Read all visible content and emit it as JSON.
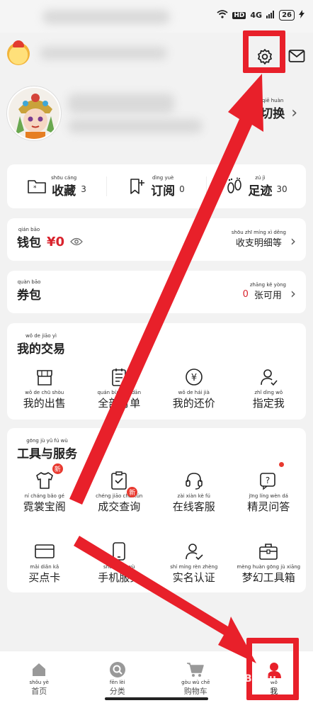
{
  "status_bar": {
    "battery": "26",
    "network_badge": "HD",
    "signal": "4G"
  },
  "header": {
    "settings_icon": "gear-icon",
    "mail_icon": "mail-icon"
  },
  "profile": {
    "switch": {
      "pinyin": "qiē huàn",
      "label": "切换"
    }
  },
  "favorites": [
    {
      "pinyin": "shōu cáng",
      "label": "收藏",
      "count": "3",
      "icon": "folder-icon"
    },
    {
      "pinyin": "dìng yuè",
      "label": "订阅",
      "count": "0",
      "icon": "bookmark-plus-icon"
    },
    {
      "pinyin": "zú jì",
      "label": "足迹",
      "count": "30",
      "icon": "footprint-icon"
    }
  ],
  "wallet": {
    "pinyin": "qián bāo",
    "label": "钱包",
    "amount": "¥0",
    "detail_pinyin": "shōu zhī míng xì děng",
    "detail_label": "收支明细等"
  },
  "coupon": {
    "pinyin": "quàn bāo",
    "label": "券包",
    "count": "0",
    "detail_pinyin": "zhāng kě yòng",
    "detail_label": "张可用"
  },
  "trades": {
    "title_pinyin": "wǒ de jiāo yì",
    "title": "我的交易",
    "items": [
      {
        "pinyin": "wǒ de chū shòu",
        "label": "我的出售",
        "icon": "shop-icon"
      },
      {
        "pinyin": "quán bù dìng dān",
        "label": "全部订单",
        "icon": "order-list-icon"
      },
      {
        "pinyin": "wǒ de hái jià",
        "label": "我的还价",
        "icon": "yen-coin-icon"
      },
      {
        "pinyin": "zhǐ dìng wǒ",
        "label": "指定我",
        "icon": "user-assign-icon"
      }
    ]
  },
  "tools": {
    "title_pinyin": "gōng jù yǔ fú wù",
    "title": "工具与服务",
    "row1": [
      {
        "pinyin": "ní cháng bǎo gé",
        "label": "霓裳宝阁",
        "icon": "tshirt-icon",
        "badge": "新"
      },
      {
        "pinyin": "chéng jiāo chá xún",
        "label": "成交查询",
        "icon": "clipboard-check-icon",
        "badge": "新"
      },
      {
        "pinyin": "zài xiàn kè fú",
        "label": "在线客服",
        "icon": "headset-icon"
      },
      {
        "pinyin": "jīng líng wèn dá",
        "label": "精灵问答",
        "icon": "question-icon",
        "dot": true
      }
    ],
    "row2": [
      {
        "pinyin": "mǎi diǎn kǎ",
        "label": "买点卡",
        "icon": "card-icon"
      },
      {
        "pinyin": "shǒu jī fú wù",
        "label": "手机服务",
        "icon": "phone-icon"
      },
      {
        "pinyin": "shí míng rèn zhèng",
        "label": "实名认证",
        "icon": "id-verify-icon"
      },
      {
        "pinyin": "mèng huàn gōng jù xiāng",
        "label": "梦幻工具箱",
        "icon": "toolbox-icon"
      }
    ]
  },
  "tabbar": [
    {
      "pinyin": "shǒu yè",
      "label": "首页",
      "icon": "home-icon"
    },
    {
      "pinyin": "fēn lèi",
      "label": "分类",
      "icon": "search-icon"
    },
    {
      "pinyin": "gòu wù chē",
      "label": "购物车",
      "icon": "cart-icon"
    },
    {
      "pinyin": "wǒ",
      "label": "我",
      "icon": "user-icon",
      "active": true
    }
  ],
  "colors": {
    "accent_red": "#e8202a",
    "price_red": "#d9232d"
  },
  "watermark": "Baidu"
}
